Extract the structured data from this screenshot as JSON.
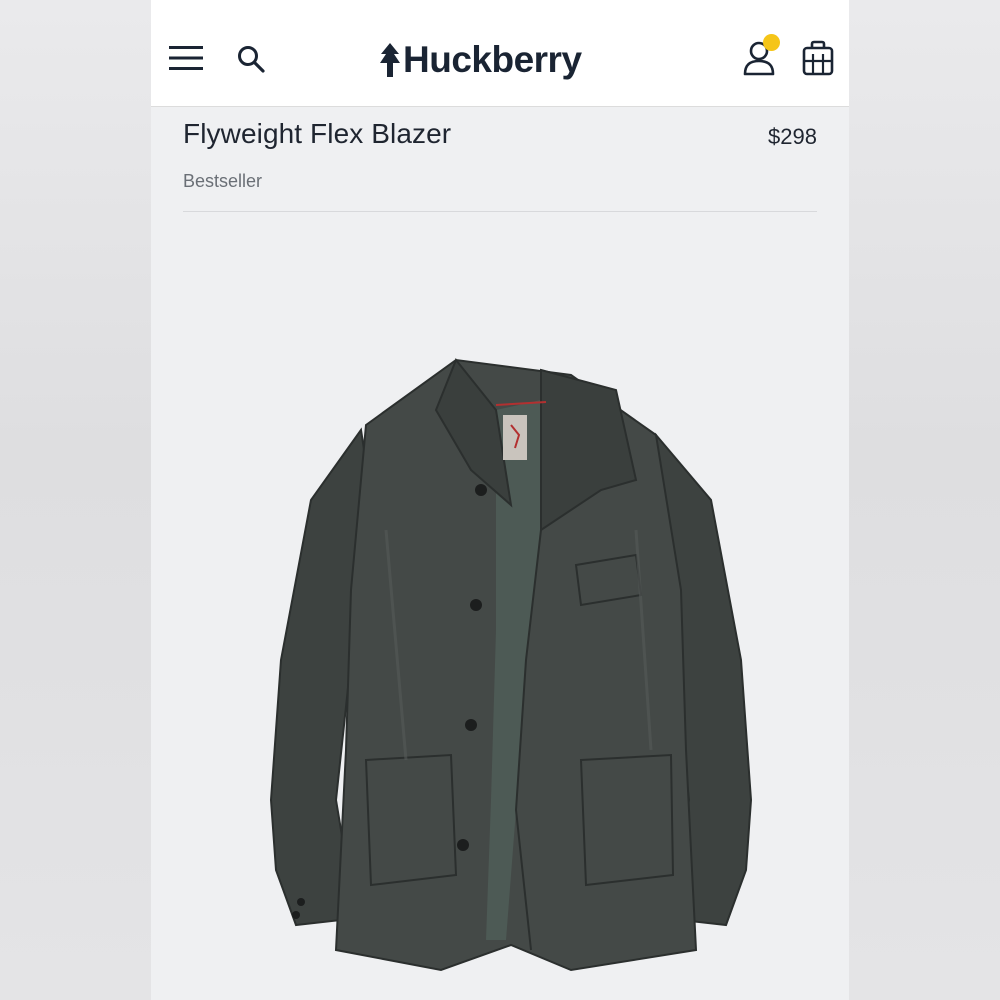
{
  "brand": {
    "name": "Huckberry"
  },
  "header": {
    "menu_icon": "hamburger-menu-icon",
    "search_icon": "search-icon",
    "account_icon": "user-account-icon",
    "cart_icon": "shopping-bag-icon",
    "notification_color": "#f5c518"
  },
  "product": {
    "title": "Flyweight Flex Blazer",
    "price": "$298",
    "badge": "Bestseller",
    "image_alt": "Dark olive-gray blazer jacket"
  },
  "colors": {
    "background": "#eff0f2",
    "header_bg": "#ffffff",
    "text": "#1f2530",
    "muted_text": "#6a6f76",
    "jacket": "#3f4442"
  }
}
